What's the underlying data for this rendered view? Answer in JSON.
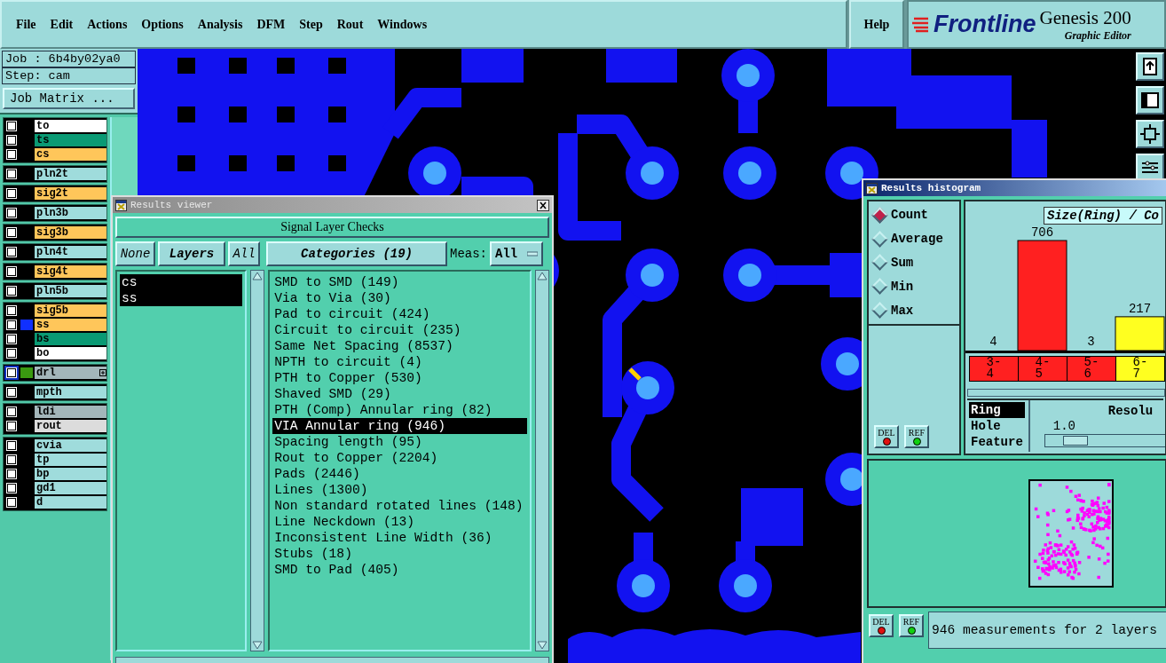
{
  "menu": [
    "File",
    "Edit",
    "Actions",
    "Options",
    "Analysis",
    "DFM",
    "Step",
    "Rout",
    "Windows"
  ],
  "help": "Help",
  "logo": {
    "brand": "Frontline",
    "product": "Genesis 200",
    "subtitle": "Graphic Editor"
  },
  "job": "Job : 6b4by02ya0",
  "step": "Step: cam",
  "job_matrix_button": "Job Matrix ...",
  "layer_groups": [
    {
      "layers": [
        {
          "name": "to",
          "color": "#ffffff",
          "checked": false,
          "active": false
        },
        {
          "name": "ts",
          "color": "#0a9a74",
          "checked": false,
          "active": false
        },
        {
          "name": "cs",
          "color": "#ffc65a",
          "checked": false,
          "active": false
        }
      ]
    },
    {
      "layers": [
        {
          "name": "pln2t",
          "color": "#9fdcdc",
          "checked": false,
          "active": false
        }
      ]
    },
    {
      "layers": [
        {
          "name": "sig2t",
          "color": "#ffc65a",
          "checked": false,
          "active": false
        }
      ]
    },
    {
      "layers": [
        {
          "name": "pln3b",
          "color": "#9fdcdc",
          "checked": false,
          "active": false
        }
      ]
    },
    {
      "layers": [
        {
          "name": "sig3b",
          "color": "#ffc65a",
          "checked": false,
          "active": false
        }
      ]
    },
    {
      "layers": [
        {
          "name": "pln4t",
          "color": "#9fdcdc",
          "checked": false,
          "active": false
        }
      ]
    },
    {
      "layers": [
        {
          "name": "sig4t",
          "color": "#ffc65a",
          "checked": false,
          "active": false
        }
      ]
    },
    {
      "layers": [
        {
          "name": "pln5b",
          "color": "#9fdcdc",
          "checked": false,
          "active": false
        }
      ]
    },
    {
      "layers": [
        {
          "name": "sig5b",
          "color": "#ffc65a",
          "checked": false,
          "active": false
        },
        {
          "name": "ss",
          "color": "#ffc65a",
          "swatch": {
            "color": "#1030ff"
          },
          "checked": false,
          "active": false
        },
        {
          "name": "bs",
          "color": "#0a9a74",
          "checked": false,
          "active": false
        },
        {
          "name": "bo",
          "color": "#ffffff",
          "checked": false,
          "active": false
        }
      ]
    },
    {
      "layers": [
        {
          "name": "drl",
          "color": "#a3b6ba",
          "swatch": {
            "color": "#3a9a10"
          },
          "checked": false,
          "active": true,
          "expandable": true
        }
      ]
    },
    {
      "layers": [
        {
          "name": "mpth",
          "color": "#9fdcdc",
          "checked": false,
          "active": false
        }
      ]
    },
    {
      "layers": [
        {
          "name": "ldi",
          "color": "#a3b6ba",
          "checked": false,
          "active": false
        },
        {
          "name": "rout",
          "color": "#dcdcdc",
          "checked": false,
          "active": false
        }
      ]
    },
    {
      "layers": [
        {
          "name": "cvia",
          "color": "#9fdcdc",
          "checked": false,
          "active": false
        },
        {
          "name": "tp",
          "color": "#9fdcdc",
          "checked": false,
          "active": false
        },
        {
          "name": "bp",
          "color": "#9fdcdc",
          "checked": false,
          "active": false
        },
        {
          "name": "gd1",
          "color": "#9fdcdc",
          "checked": false,
          "active": false
        },
        {
          "name": "d",
          "color": "#9fdcdc",
          "checked": false,
          "active": false
        }
      ]
    }
  ],
  "results_viewer": {
    "title": "Results viewer",
    "header_button": "Signal Layer Checks",
    "none_button": "None",
    "layers_label": "Layers",
    "all_button": "All",
    "categories_button": "Categories (19)",
    "meas_label": "Meas:",
    "meas_value": "All",
    "layers": [
      {
        "name": "cs",
        "selected": true
      },
      {
        "name": "ss",
        "selected": true
      }
    ],
    "categories": [
      {
        "label": "SMD to SMD (149)",
        "selected": false
      },
      {
        "label": "Via to Via (30)",
        "selected": false
      },
      {
        "label": "Pad to circuit (424)",
        "selected": false
      },
      {
        "label": "Circuit to circuit (235)",
        "selected": false
      },
      {
        "label": "Same Net Spacing (8537)",
        "selected": false
      },
      {
        "label": "NPTH to circuit (4)",
        "selected": false
      },
      {
        "label": "PTH to Copper (530)",
        "selected": false
      },
      {
        "label": "Shaved SMD (29)",
        "selected": false
      },
      {
        "label": "PTH (Comp) Annular ring (82)",
        "selected": false
      },
      {
        "label": "VIA Annular ring (946)",
        "selected": true
      },
      {
        "label": "Spacing length (95)",
        "selected": false
      },
      {
        "label": "Rout to Copper (2204)",
        "selected": false
      },
      {
        "label": "Pads (2446)",
        "selected": false
      },
      {
        "label": "Lines (1300)",
        "selected": false
      },
      {
        "label": "Non standard rotated lines (148)",
        "selected": false
      },
      {
        "label": "Line Neckdown (13)",
        "selected": false
      },
      {
        "label": "Inconsistent Line Width (36)",
        "selected": false
      },
      {
        "label": "Stubs (18)",
        "selected": false
      },
      {
        "label": "SMD to Pad (405)",
        "selected": false
      }
    ]
  },
  "histogram": {
    "title": "Results histogram",
    "modes": [
      {
        "label": "Count",
        "selected": true
      },
      {
        "label": "Average",
        "selected": false
      },
      {
        "label": "Sum",
        "selected": false
      },
      {
        "label": "Min",
        "selected": false
      },
      {
        "label": "Max",
        "selected": false
      }
    ],
    "chart_buttons": [
      "DEL",
      "REF"
    ],
    "chart_data": {
      "type": "bar",
      "title": "Size(Ring) / Co",
      "categories": [
        "3-4",
        "4-5",
        "5-6",
        "6-7"
      ],
      "values": [
        4,
        706,
        3,
        217
      ],
      "data_labels": true
    },
    "bins": [
      {
        "color": "#ff2020"
      },
      {
        "color": "#ff2020"
      },
      {
        "color": "#ff2020"
      },
      {
        "color": "#ffff20"
      }
    ],
    "attributes": [
      {
        "label": "Ring",
        "selected": true
      },
      {
        "label": "Hole",
        "selected": false
      },
      {
        "label": "Feature",
        "selected": false
      }
    ],
    "resolution": {
      "label": "Resolu",
      "value": "1.0",
      "level": 0.12
    },
    "map_buttons": [
      "DEL",
      "REF"
    ],
    "status": "946 measurements for 2 layers"
  }
}
